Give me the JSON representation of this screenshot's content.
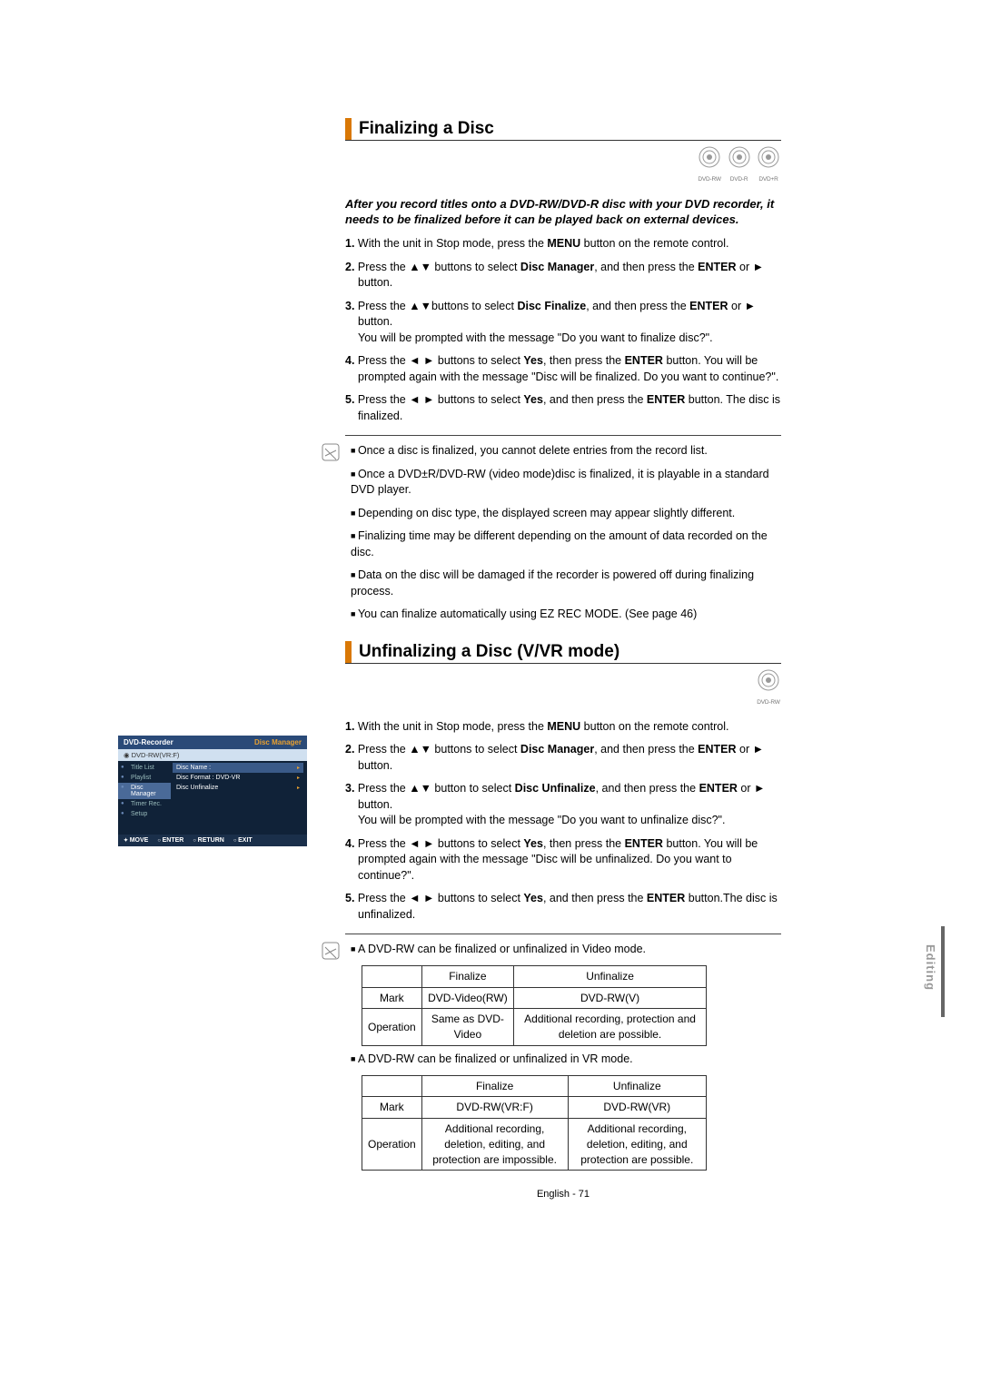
{
  "section1": {
    "title": "Finalizing a Disc",
    "discs": [
      "DVD-RW",
      "DVD-R",
      "DVD+R"
    ],
    "intro": "After you record titles onto a DVD-RW/DVD-R disc with your DVD recorder, it needs to be ﬁnalized before it can be played back on external devices.",
    "steps": [
      "With the unit in Stop mode, press the <b>MENU</b> button on the remote control.",
      "Press the ▲▼ buttons to select <b>Disc Manager</b>, and then press the <b>ENTER</b> or ► button.",
      "Press the ▲▼buttons to select <b>Disc Finalize</b>, and then press the <b>ENTER</b> or ► button.<br>You will be prompted with the message \"Do you want to ﬁnalize disc?\".",
      "Press the ◄ ► buttons to select <b>Yes</b>, then press the <b>ENTER</b> button. You will be prompted again with the message \"Disc will be ﬁnalized. Do you want to continue?\".",
      "Press the ◄ ► buttons to select <b>Yes</b>, and then press the <b>ENTER</b> button. The disc is ﬁnalized."
    ],
    "notes": [
      "Once a disc is ﬁnalized, you cannot delete entries from the record list.",
      "Once a DVD±R/DVD-RW (video mode)disc is ﬁnalized, it is playable in a standard DVD player.",
      "Depending on disc type, the displayed screen may appear slightly different.",
      "Finalizing time may be different depending on the amount of data recorded on the disc.",
      "Data on the disc will be damaged if the recorder is powered off during ﬁnalizing process.",
      "You can ﬁnalize automatically using EZ REC MODE. (See page 46)"
    ]
  },
  "section2": {
    "title": "Unﬁnalizing a Disc (V/VR mode)",
    "discs": [
      "DVD-RW"
    ],
    "steps": [
      "With the unit in Stop mode, press the <b>MENU</b> button on the remote control.",
      "Press the ▲▼ buttons to select <b>Disc Manager</b>, and then press the <b>ENTER</b> or ► button.",
      "Press the ▲▼ button to select <b>Disc Unﬁnalize</b>, and then press the <b>ENTER</b> or ► button.<br>You will be prompted with the message \"Do you want to unﬁnalize disc?\".",
      "Press the ◄ ► buttons to select <b>Yes</b>, then press the <b>ENTER</b> button. You will be prompted again with the message \"Disc will be unﬁnalized. Do you want to continue?\".",
      "Press the ◄ ► buttons to select <b>Yes</b>, and then press the <b>ENTER</b> button.The disc is unﬁnalized."
    ],
    "note_a": "A DVD-RW can be ﬁnalized or unﬁnalized in Video mode.",
    "table_a": {
      "head": [
        "",
        "Finalize",
        "Unﬁnalize"
      ],
      "rows": [
        [
          "Mark",
          "DVD-Video(RW)",
          "DVD-RW(V)"
        ],
        [
          "Operation",
          "Same as DVD-Video",
          "Additional recording, protection and deletion are possible."
        ]
      ]
    },
    "note_b": "A DVD-RW can be ﬁnalized or unﬁnalized in VR mode.",
    "table_b": {
      "head": [
        "",
        "Finalize",
        "Unﬁnalize"
      ],
      "rows": [
        [
          "Mark",
          "DVD-RW(VR:F)",
          "DVD-RW(VR)"
        ],
        [
          "Operation",
          "Additional recording, deletion, editing, and protection are impossible.",
          "Additional recording, deletion, editing, and protection are possible."
        ]
      ]
    }
  },
  "osd": {
    "title_left": "DVD-Recorder",
    "title_right": "Disc Manager",
    "sub": "DVD-RW(VR:F)",
    "menu": [
      "Title List",
      "Playlist",
      "Disc Manager",
      "Timer Rec.",
      "Setup"
    ],
    "menu_sel": 2,
    "rows": [
      {
        "label": "Disc Name :",
        "sel": true
      },
      {
        "label": "Disc Format : DVD-VR",
        "sel": false
      },
      {
        "label": "Disc Unﬁnalize",
        "sel": false
      }
    ],
    "footer": [
      "MOVE",
      "ENTER",
      "RETURN",
      "EXIT"
    ]
  },
  "footer": "English - 71",
  "side_tab": "Editing"
}
